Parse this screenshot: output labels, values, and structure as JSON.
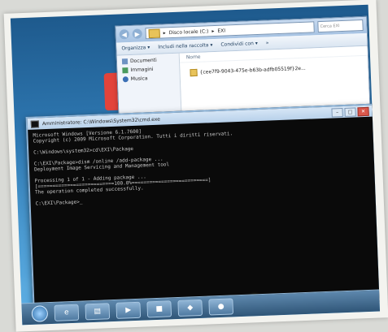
{
  "explorer": {
    "nav_back_icon": "back-arrow-icon",
    "nav_forward_icon": "forward-arrow-icon",
    "address_parts": [
      "Disco locale (C:)",
      "EXI"
    ],
    "address_sep": "▸",
    "search_placeholder": "Cerca EXI",
    "toolbar": [
      "Organizza ▾",
      "Includi nella raccolta ▾",
      "Condividi con ▾",
      "»"
    ],
    "nav_items": [
      {
        "label": "Documenti",
        "icon": "documents-icon",
        "color": "#6f93c3"
      },
      {
        "label": "Immagini",
        "icon": "pictures-icon",
        "color": "#4a9a5e"
      },
      {
        "label": "Musica",
        "icon": "music-icon",
        "color": "#3b6fb5"
      }
    ],
    "content_header": "Nome",
    "file_name": "{cee7f9-9043-475e-b63b-adfb05519f}2e..."
  },
  "cmd": {
    "title": "Amministratore: C:\\Windows\\System32\\cmd.exe",
    "buttons": [
      "–",
      "□",
      "✕"
    ],
    "lines": [
      "Microsoft Windows [Versione 6.1.7600]",
      "Copyright (c) 2009 Microsoft Corporation. Tutti i diritti riservati.",
      "",
      "C:\\Windows\\system32>cd\\EXI\\Package",
      "",
      "C:\\EXI\\Package>dism /online /add-package ...",
      "Deployment Image Servicing and Management tool",
      "",
      "Processing 1 of 1 - Adding package ...",
      "[==========================100.0%==========================]",
      "The operation completed successfully.",
      "",
      "C:\\EXI\\Package>_"
    ]
  },
  "taskbar": {
    "start_icon": "windows-orb-icon",
    "buttons": [
      {
        "glyph": "e",
        "icon": "ie-icon"
      },
      {
        "glyph": "▤",
        "icon": "explorer-icon"
      },
      {
        "glyph": "▶",
        "icon": "media-player-icon"
      },
      {
        "glyph": "■",
        "icon": "cmd-icon"
      },
      {
        "glyph": "◆",
        "icon": "app-icon"
      },
      {
        "glyph": "●",
        "icon": "app-icon-2"
      }
    ]
  },
  "cursor_icon": "pointer-cursor-icon"
}
